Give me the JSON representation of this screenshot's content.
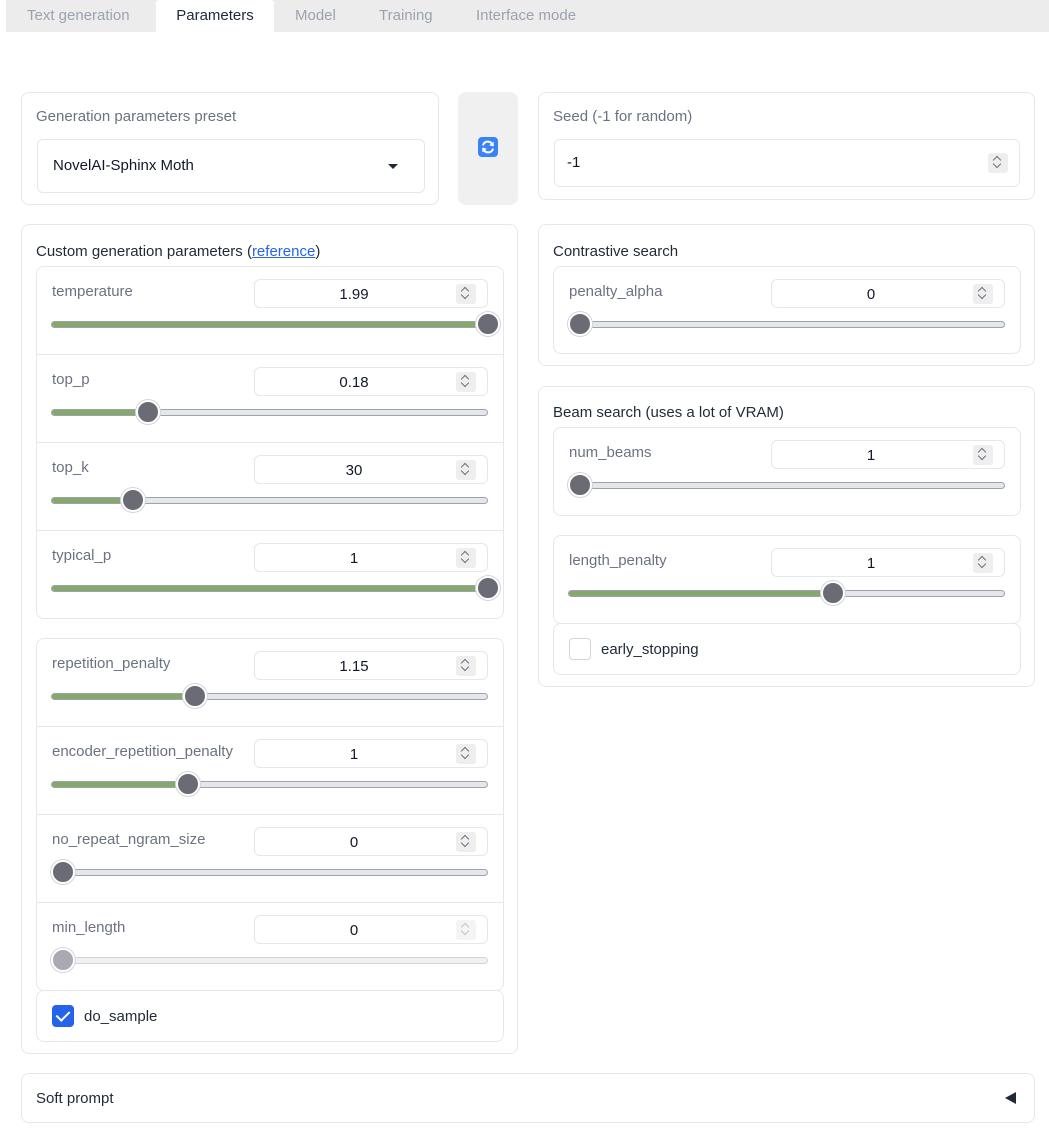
{
  "tabs": [
    {
      "label": "Text generation",
      "active": false
    },
    {
      "label": "Parameters",
      "active": true
    },
    {
      "label": "Model",
      "active": false
    },
    {
      "label": "Training",
      "active": false
    },
    {
      "label": "Interface mode",
      "active": false
    }
  ],
  "preset": {
    "label": "Generation parameters preset",
    "value": "NovelAI-Sphinx Moth"
  },
  "refresh_icon": "refresh-icon",
  "seed": {
    "label": "Seed (-1 for random)",
    "value": "-1"
  },
  "custom": {
    "title_prefix": "Custom generation parameters (",
    "link": "reference",
    "title_suffix": ")",
    "sampling": [
      {
        "name": "temperature",
        "value": "1.99",
        "fraction": 1.0
      },
      {
        "name": "top_p",
        "value": "0.18",
        "fraction": 0.2
      },
      {
        "name": "top_k",
        "value": "30",
        "fraction": 0.165
      },
      {
        "name": "typical_p",
        "value": "1",
        "fraction": 1.0
      }
    ],
    "penalties": [
      {
        "name": "repetition_penalty",
        "value": "1.15",
        "fraction": 0.31
      },
      {
        "name": "encoder_repetition_penalty",
        "value": "1",
        "fraction": 0.295
      },
      {
        "name": "no_repeat_ngram_size",
        "value": "0",
        "fraction": 0.0
      },
      {
        "name": "min_length",
        "value": "0",
        "fraction": 0.0,
        "disabled": true
      }
    ],
    "do_sample": {
      "label": "do_sample",
      "checked": true
    }
  },
  "contrastive": {
    "title": "Contrastive search",
    "penalty_alpha": {
      "name": "penalty_alpha",
      "value": "0",
      "fraction": 0.0
    }
  },
  "beam": {
    "title": "Beam search (uses a lot of VRAM)",
    "num_beams": {
      "name": "num_beams",
      "value": "1",
      "fraction": 0.0
    },
    "length_penalty": {
      "name": "length_penalty",
      "value": "1",
      "fraction": 0.595
    },
    "early_stopping": {
      "label": "early_stopping",
      "checked": false
    }
  },
  "soft_prompt": {
    "label": "Soft prompt"
  },
  "colors": {
    "accent_fill": "#86a86a",
    "checkbox_blue": "#2563eb",
    "refresh_blue": "#3b82f6"
  }
}
